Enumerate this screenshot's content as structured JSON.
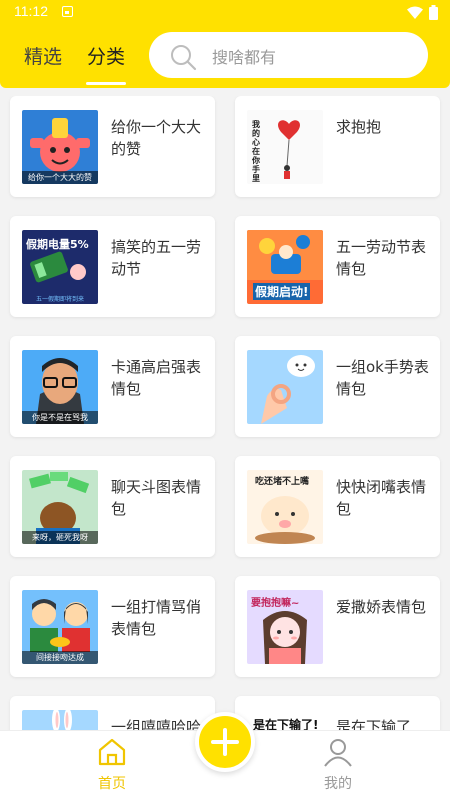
{
  "status_bar": {
    "time": "11:12"
  },
  "header": {
    "tabs": [
      {
        "label": "精选"
      },
      {
        "label": "分类"
      }
    ],
    "search": {
      "placeholder": "搜啥都有"
    }
  },
  "cards": [
    {
      "title": "给你一个大大的赞",
      "thumb_caption": "给你一个大大的赞"
    },
    {
      "title": "求抱抱",
      "thumb_text": "我的心在你手里"
    },
    {
      "title": "搞笑的五一劳动节",
      "thumb_text": "假期电量5%",
      "thumb_caption": "五一假期即将到来"
    },
    {
      "title": "五一劳动节表情包",
      "thumb_text": "假期启动!"
    },
    {
      "title": "卡通高启强表情包",
      "thumb_caption": "你是不是在骂我"
    },
    {
      "title": "一组ok手势表情包"
    },
    {
      "title": "聊天斗图表情包",
      "thumb_caption": "来呀，砸死我呀"
    },
    {
      "title": "快快闭嘴表情包",
      "thumb_text": "吃还堵不上嘴"
    },
    {
      "title": "一组打情骂俏表情包",
      "thumb_caption": "间接接吻达成"
    },
    {
      "title": "爱撒娇表情包",
      "thumb_text": "要抱抱嘛~"
    },
    {
      "title": "一组嘻嘻哈哈"
    },
    {
      "title": "是在下输了",
      "thumb_text": "是在下输了!"
    }
  ],
  "bottom_nav": {
    "home_label": "首页",
    "mine_label": "我的"
  },
  "colors": {
    "accent": "#ffe100",
    "nav_active": "#f0c500"
  }
}
